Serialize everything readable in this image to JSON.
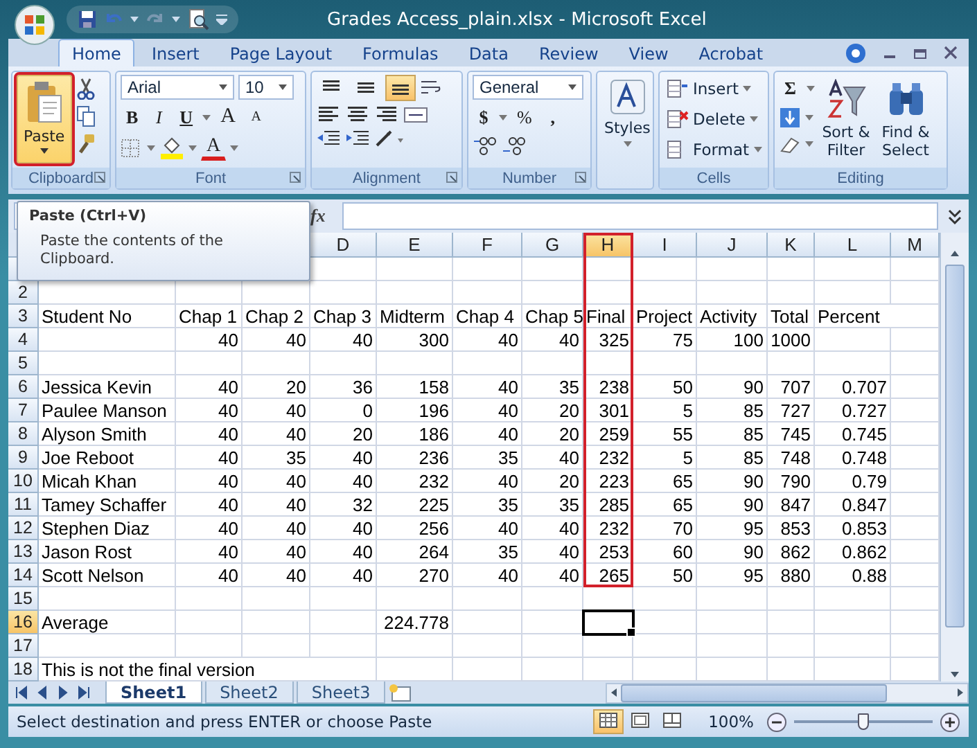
{
  "window": {
    "title": "Grades Access_plain.xlsx - Microsoft Excel"
  },
  "tabs": [
    {
      "label": "Home",
      "selected": true
    },
    {
      "label": "Insert",
      "selected": false
    },
    {
      "label": "Page Layout",
      "selected": false
    },
    {
      "label": "Formulas",
      "selected": false
    },
    {
      "label": "Data",
      "selected": false
    },
    {
      "label": "Review",
      "selected": false
    },
    {
      "label": "View",
      "selected": false
    },
    {
      "label": "Acrobat",
      "selected": false
    }
  ],
  "clipboard": {
    "label": "Clipboard",
    "paste": {
      "label": "Paste",
      "outlined": true
    }
  },
  "font": {
    "label": "Font",
    "font_name": "Arial",
    "font_size": "10",
    "bold": "B",
    "italic": "I",
    "underline": "U",
    "grow": "A",
    "shrink": "A",
    "text_color_glyph": "A"
  },
  "alignment": {
    "label": "Alignment",
    "vertical_align": [
      {
        "selected": false
      },
      {
        "selected": false
      },
      {
        "selected": true
      }
    ]
  },
  "number": {
    "label": "Number",
    "format": "General",
    "currency": "$",
    "percent": "%",
    "comma": ","
  },
  "styles": {
    "label": "Styles"
  },
  "cells": {
    "label": "Cells",
    "buttons": [
      "Insert",
      "Delete",
      "Format"
    ]
  },
  "editing": {
    "label": "Editing",
    "sum": "Σ",
    "sort": "Sort & Filter",
    "find": "Find & Select"
  },
  "formula_bar": {
    "function_label": "fx"
  },
  "tooltip": {
    "title": "Paste (Ctrl+V)",
    "text": "Paste the contents of the Clipboard."
  },
  "columns": [
    {},
    {},
    {},
    {
      "letter": "D",
      "selected": false,
      "outlined": false
    },
    {
      "letter": "E",
      "selected": false,
      "outlined": false
    },
    {
      "letter": "F",
      "selected": false,
      "outlined": false
    },
    {
      "letter": "G",
      "selected": false,
      "outlined": false
    },
    {
      "letter": "H",
      "selected": true,
      "outlined": true
    },
    {
      "letter": "I",
      "selected": false,
      "outlined": false
    },
    {
      "letter": "J",
      "selected": false,
      "outlined": false
    },
    {
      "letter": "K",
      "selected": false,
      "outlined": false
    },
    {
      "letter": "L",
      "selected": false,
      "outlined": false
    },
    {
      "letter": "M",
      "selected": false,
      "outlined": false
    }
  ],
  "rows": [
    {
      "cells": []
    },
    {
      "number": "2",
      "selected": false,
      "cells": []
    },
    {
      "number": "3",
      "selected": false,
      "cells": [
        {
          "value": "Student No",
          "kind": "text"
        },
        {
          "value": "Chap 1",
          "kind": "text"
        },
        {
          "value": "Chap 2",
          "kind": "text"
        },
        {
          "value": "Chap 3",
          "kind": "text"
        },
        {
          "value": "Midterm",
          "kind": "text"
        },
        {
          "value": "Chap 4",
          "kind": "text"
        },
        {
          "value": "Chap 5",
          "kind": "text"
        },
        {
          "value": "Final",
          "kind": "text"
        },
        {
          "value": "Project",
          "kind": "text"
        },
        {
          "value": "Activity",
          "kind": "text"
        },
        {
          "value": "Total",
          "kind": "text"
        },
        {
          "value": "Percent",
          "kind": "text"
        }
      ]
    },
    {
      "number": "4",
      "selected": false,
      "cells": [
        null,
        {
          "value": "40",
          "kind": "number"
        },
        {
          "value": "40",
          "kind": "number"
        },
        {
          "value": "40",
          "kind": "number"
        },
        {
          "value": "300",
          "kind": "number"
        },
        {
          "value": "40",
          "kind": "number"
        },
        {
          "value": "40",
          "kind": "number"
        },
        {
          "value": "325",
          "kind": "number"
        },
        {
          "value": "75",
          "kind": "number"
        },
        {
          "value": "100",
          "kind": "number"
        },
        {
          "value": "1000",
          "kind": "number"
        }
      ]
    },
    {
      "number": "5",
      "selected": false,
      "cells": []
    },
    {
      "number": "6",
      "selected": false,
      "cells": [
        {
          "value": "Jessica Kevin",
          "kind": "text"
        },
        {
          "value": "40",
          "kind": "number"
        },
        {
          "value": "20",
          "kind": "number"
        },
        {
          "value": "36",
          "kind": "number"
        },
        {
          "value": "158",
          "kind": "number"
        },
        {
          "value": "40",
          "kind": "number"
        },
        {
          "value": "35",
          "kind": "number"
        },
        {
          "value": "238",
          "kind": "number"
        },
        {
          "value": "50",
          "kind": "number"
        },
        {
          "value": "90",
          "kind": "number"
        },
        {
          "value": "707",
          "kind": "number"
        },
        {
          "value": "0.707",
          "kind": "number"
        }
      ]
    },
    {
      "number": "7",
      "selected": false,
      "cells": [
        {
          "value": "Paulee Manson",
          "kind": "text"
        },
        {
          "value": "40",
          "kind": "number"
        },
        {
          "value": "40",
          "kind": "number"
        },
        {
          "value": "0",
          "kind": "number"
        },
        {
          "value": "196",
          "kind": "number"
        },
        {
          "value": "40",
          "kind": "number"
        },
        {
          "value": "20",
          "kind": "number"
        },
        {
          "value": "301",
          "kind": "number"
        },
        {
          "value": "5",
          "kind": "number"
        },
        {
          "value": "85",
          "kind": "number"
        },
        {
          "value": "727",
          "kind": "number"
        },
        {
          "value": "0.727",
          "kind": "number"
        }
      ]
    },
    {
      "number": "8",
      "selected": false,
      "cells": [
        {
          "value": "Alyson Smith",
          "kind": "text"
        },
        {
          "value": "40",
          "kind": "number"
        },
        {
          "value": "40",
          "kind": "number"
        },
        {
          "value": "20",
          "kind": "number"
        },
        {
          "value": "186",
          "kind": "number"
        },
        {
          "value": "40",
          "kind": "number"
        },
        {
          "value": "20",
          "kind": "number"
        },
        {
          "value": "259",
          "kind": "number"
        },
        {
          "value": "55",
          "kind": "number"
        },
        {
          "value": "85",
          "kind": "number"
        },
        {
          "value": "745",
          "kind": "number"
        },
        {
          "value": "0.745",
          "kind": "number"
        }
      ]
    },
    {
      "number": "9",
      "selected": false,
      "cells": [
        {
          "value": "Joe Reboot",
          "kind": "text"
        },
        {
          "value": "40",
          "kind": "number"
        },
        {
          "value": "35",
          "kind": "number"
        },
        {
          "value": "40",
          "kind": "number"
        },
        {
          "value": "236",
          "kind": "number"
        },
        {
          "value": "35",
          "kind": "number"
        },
        {
          "value": "40",
          "kind": "number"
        },
        {
          "value": "232",
          "kind": "number"
        },
        {
          "value": "5",
          "kind": "number"
        },
        {
          "value": "85",
          "kind": "number"
        },
        {
          "value": "748",
          "kind": "number"
        },
        {
          "value": "0.748",
          "kind": "number"
        }
      ]
    },
    {
      "number": "10",
      "selected": false,
      "cells": [
        {
          "value": "Micah Khan",
          "kind": "text"
        },
        {
          "value": "40",
          "kind": "number"
        },
        {
          "value": "40",
          "kind": "number"
        },
        {
          "value": "40",
          "kind": "number"
        },
        {
          "value": "232",
          "kind": "number"
        },
        {
          "value": "40",
          "kind": "number"
        },
        {
          "value": "20",
          "kind": "number"
        },
        {
          "value": "223",
          "kind": "number"
        },
        {
          "value": "65",
          "kind": "number"
        },
        {
          "value": "90",
          "kind": "number"
        },
        {
          "value": "790",
          "kind": "number"
        },
        {
          "value": "0.79",
          "kind": "number"
        }
      ]
    },
    {
      "number": "11",
      "selected": false,
      "cells": [
        {
          "value": "Tamey Schaffer",
          "kind": "text"
        },
        {
          "value": "40",
          "kind": "number"
        },
        {
          "value": "40",
          "kind": "number"
        },
        {
          "value": "32",
          "kind": "number"
        },
        {
          "value": "225",
          "kind": "number"
        },
        {
          "value": "35",
          "kind": "number"
        },
        {
          "value": "35",
          "kind": "number"
        },
        {
          "value": "285",
          "kind": "number"
        },
        {
          "value": "65",
          "kind": "number"
        },
        {
          "value": "90",
          "kind": "number"
        },
        {
          "value": "847",
          "kind": "number"
        },
        {
          "value": "0.847",
          "kind": "number"
        }
      ]
    },
    {
      "number": "12",
      "selected": false,
      "cells": [
        {
          "value": "Stephen Diaz",
          "kind": "text"
        },
        {
          "value": "40",
          "kind": "number"
        },
        {
          "value": "40",
          "kind": "number"
        },
        {
          "value": "40",
          "kind": "number"
        },
        {
          "value": "256",
          "kind": "number"
        },
        {
          "value": "40",
          "kind": "number"
        },
        {
          "value": "40",
          "kind": "number"
        },
        {
          "value": "232",
          "kind": "number"
        },
        {
          "value": "70",
          "kind": "number"
        },
        {
          "value": "95",
          "kind": "number"
        },
        {
          "value": "853",
          "kind": "number"
        },
        {
          "value": "0.853",
          "kind": "number"
        }
      ]
    },
    {
      "number": "13",
      "selected": false,
      "cells": [
        {
          "value": "Jason Rost",
          "kind": "text"
        },
        {
          "value": "40",
          "kind": "number"
        },
        {
          "value": "40",
          "kind": "number"
        },
        {
          "value": "40",
          "kind": "number"
        },
        {
          "value": "264",
          "kind": "number"
        },
        {
          "value": "35",
          "kind": "number"
        },
        {
          "value": "40",
          "kind": "number"
        },
        {
          "value": "253",
          "kind": "number"
        },
        {
          "value": "60",
          "kind": "number"
        },
        {
          "value": "90",
          "kind": "number"
        },
        {
          "value": "862",
          "kind": "number"
        },
        {
          "value": "0.862",
          "kind": "number"
        }
      ]
    },
    {
      "number": "14",
      "selected": false,
      "cells": [
        {
          "value": "Scott Nelson",
          "kind": "text"
        },
        {
          "value": "40",
          "kind": "number"
        },
        {
          "value": "40",
          "kind": "number"
        },
        {
          "value": "40",
          "kind": "number"
        },
        {
          "value": "270",
          "kind": "number"
        },
        {
          "value": "40",
          "kind": "number"
        },
        {
          "value": "40",
          "kind": "number"
        },
        {
          "value": "265",
          "kind": "number"
        },
        {
          "value": "50",
          "kind": "number"
        },
        {
          "value": "95",
          "kind": "number"
        },
        {
          "value": "880",
          "kind": "number"
        },
        {
          "value": "0.88",
          "kind": "number"
        }
      ]
    },
    {
      "number": "15",
      "selected": false,
      "cells": []
    },
    {
      "number": "16",
      "selected": true,
      "cells": [
        {
          "value": "Average",
          "kind": "text"
        },
        null,
        null,
        null,
        {
          "value": "224.778",
          "kind": "number"
        }
      ]
    },
    {
      "number": "17",
      "selected": false,
      "cells": []
    },
    {
      "number": "18",
      "selected": false,
      "cells": [
        {
          "value": "This is not the final version",
          "kind": "text"
        }
      ]
    }
  ],
  "sheets": [
    {
      "label": "Sheet1",
      "selected": true
    },
    {
      "label": "Sheet2",
      "selected": false
    },
    {
      "label": "Sheet3",
      "selected": false
    }
  ],
  "status_bar": {
    "message": "Select destination and press ENTER or choose Paste",
    "views": [
      {
        "selected": true
      },
      {
        "selected": false
      },
      {
        "selected": false
      }
    ],
    "zoom": "100%",
    "zoom_level": {
      "level": 0.5
    }
  }
}
